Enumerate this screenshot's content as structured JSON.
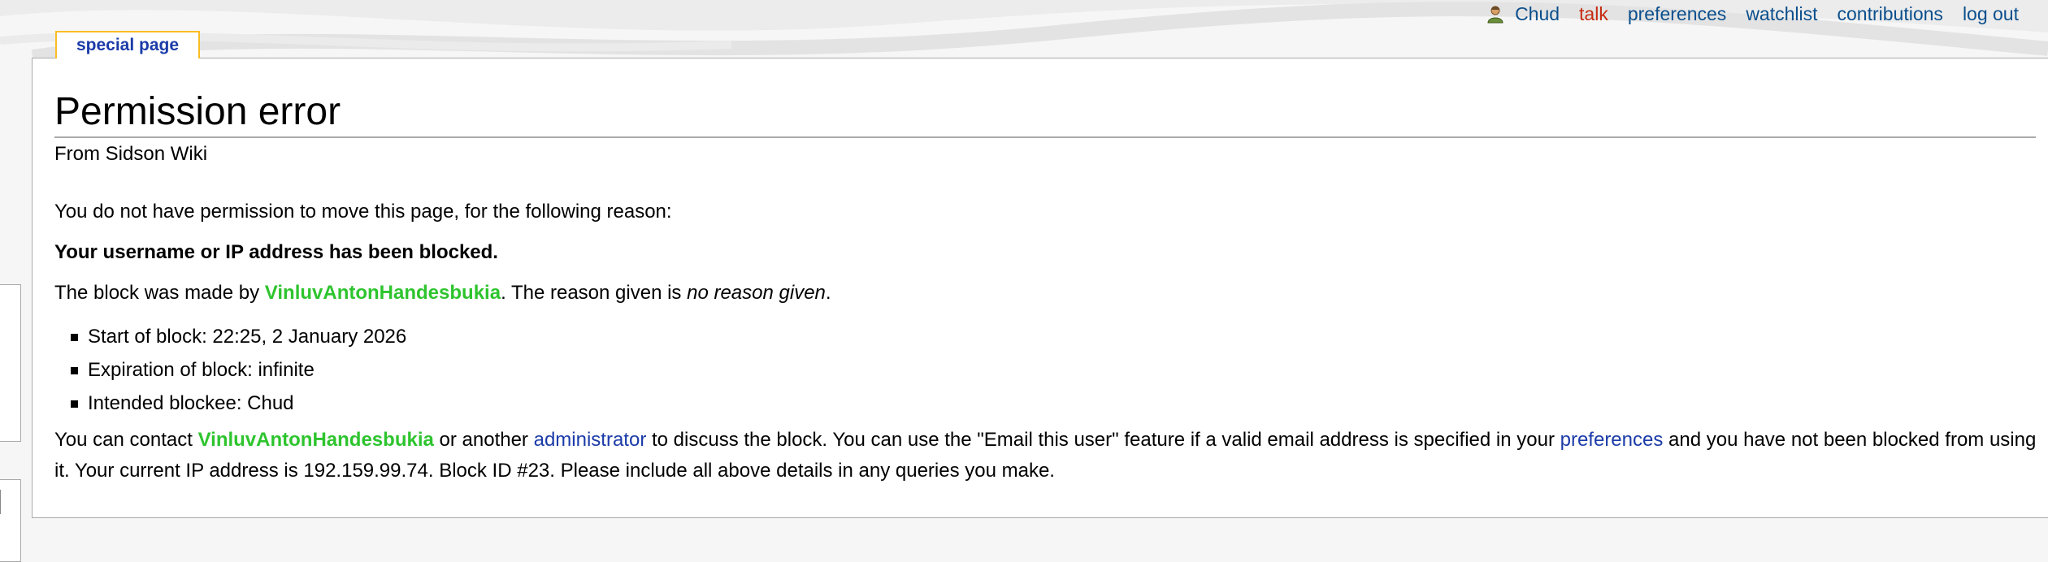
{
  "personal": {
    "user": "Chud",
    "talk": "talk",
    "preferences": "preferences",
    "watchlist": "watchlist",
    "contributions": "contributions",
    "logout": "log out"
  },
  "tab": {
    "label": "special page"
  },
  "page": {
    "title": "Permission error",
    "site_sub": "From Sidson Wiki",
    "intro": "You do not have permission to move this page, for the following reason:",
    "blocked_notice": "Your username or IP address has been blocked.",
    "block_made_prefix": "The block was made by ",
    "blocker": "VinluvAntonHandesbukia",
    "reason_prefix": ". The reason given is ",
    "reason": "no reason given",
    "reason_suffix": ".",
    "details": [
      "Start of block: 22:25, 2 January 2026",
      "Expiration of block: infinite",
      "Intended blockee: Chud"
    ],
    "contact_prefix": "You can contact ",
    "contact_blocker": "VinluvAntonHandesbukia",
    "contact_mid": " or another ",
    "administrator": "administrator",
    "contact_mid2": " to discuss the block. You can use the \"Email this user\" feature if a valid email address is specified in your ",
    "preferences_link": "preferences",
    "contact_suffix": " and you have not been blocked from using it. Your current IP address is 192.159.99.74. Block ID #23. Please include all above details in any queries you make."
  },
  "colors": {
    "link_blue": "#1b3ba8",
    "personal_blue": "#0b4f8c",
    "talk_red": "#c62a10",
    "user_green": "#2ec42e",
    "tab_border": "#fabd23"
  },
  "icons": {
    "user": "user-icon"
  }
}
